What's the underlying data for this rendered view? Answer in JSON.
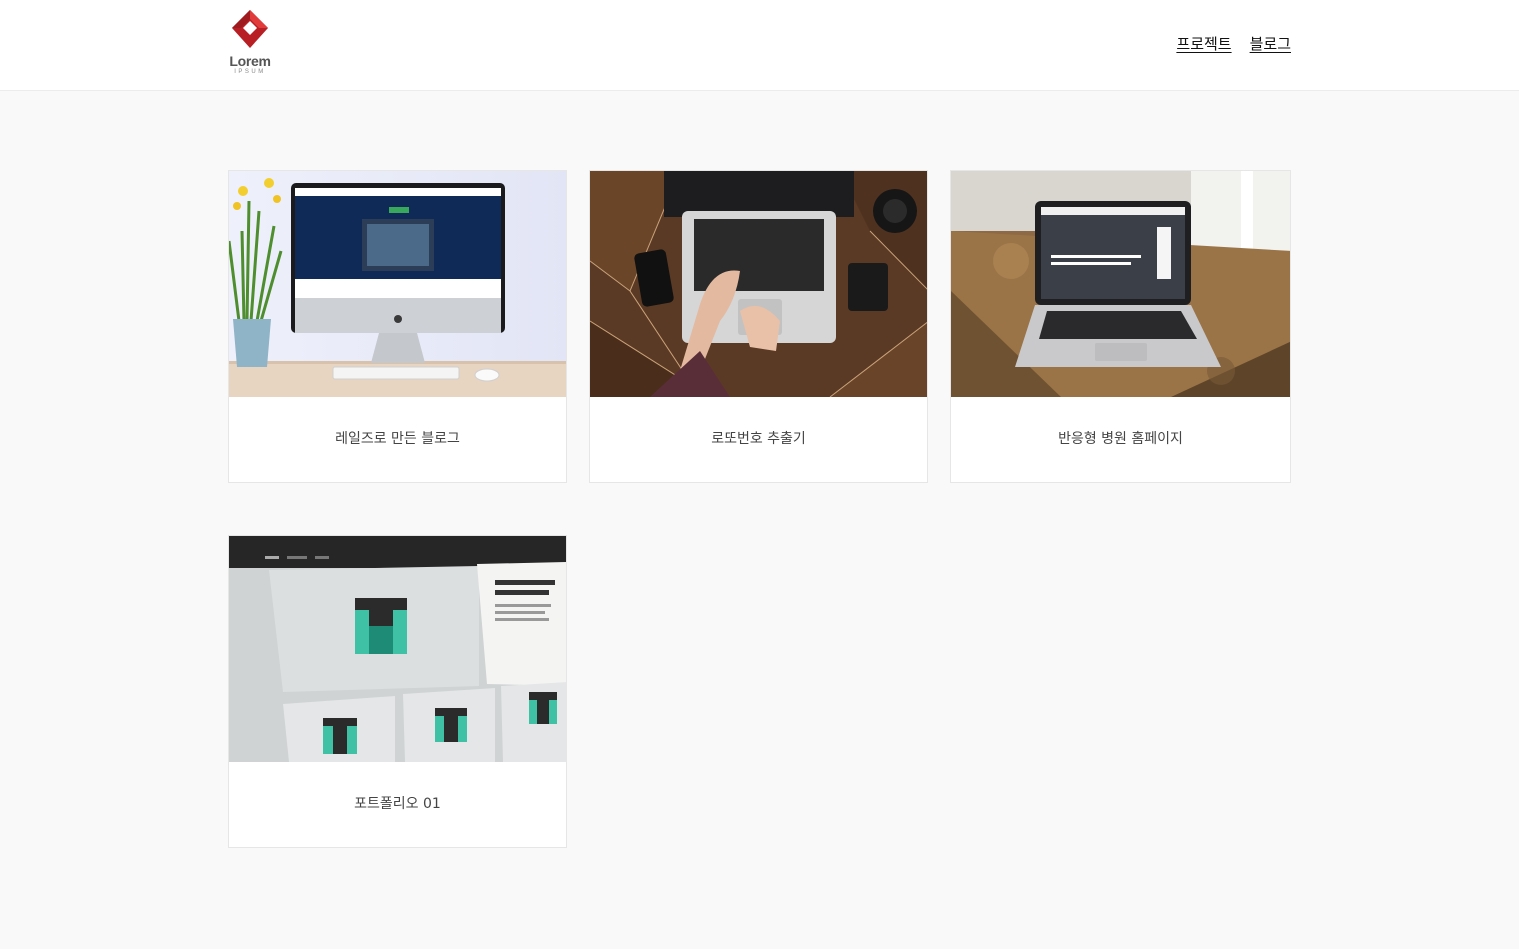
{
  "header": {
    "logo": {
      "word": "Lorem",
      "sub": "IPSUM",
      "accent_color": "#d42a2a"
    },
    "nav": [
      {
        "label": "프로젝트"
      },
      {
        "label": "블로그"
      }
    ]
  },
  "projects": [
    {
      "title": "레일즈로 만든 블로그",
      "image": "imac-desk-photo"
    },
    {
      "title": "로또번호 추출기",
      "image": "laptop-typing-photo"
    },
    {
      "title": "반응형 병원 홈페이지",
      "image": "macbook-table-photo"
    },
    {
      "title": "포트폴리오 01",
      "image": "web-design-screens-photo"
    }
  ]
}
